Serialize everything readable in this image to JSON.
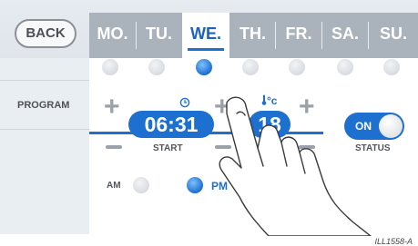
{
  "header": {
    "back_label": "BACK",
    "days": [
      {
        "label": "MO."
      },
      {
        "label": "TU."
      },
      {
        "label": "WE.",
        "selected": true
      },
      {
        "label": "TH."
      },
      {
        "label": "FR."
      },
      {
        "label": "SA."
      },
      {
        "label": "SU."
      }
    ]
  },
  "sidebar": {
    "program_label": "PROGRAM"
  },
  "program": {
    "start_time": "06:31",
    "start_label": "START",
    "temperature": "18",
    "temp_unit": "°c",
    "status_label": "STATUS",
    "toggle_label": "ON",
    "am_label": "AM",
    "pm_label": "PM",
    "selected_period": "PM"
  },
  "caption": "ILL1558-A",
  "colors": {
    "accent": "#1d6fd0",
    "panel": "#e9eef3",
    "tabbar": "#aab3bc"
  },
  "icons": {
    "time": "clock-icon",
    "temperature": "thermometer-icon",
    "overlay": "hand-pointer-icon"
  }
}
